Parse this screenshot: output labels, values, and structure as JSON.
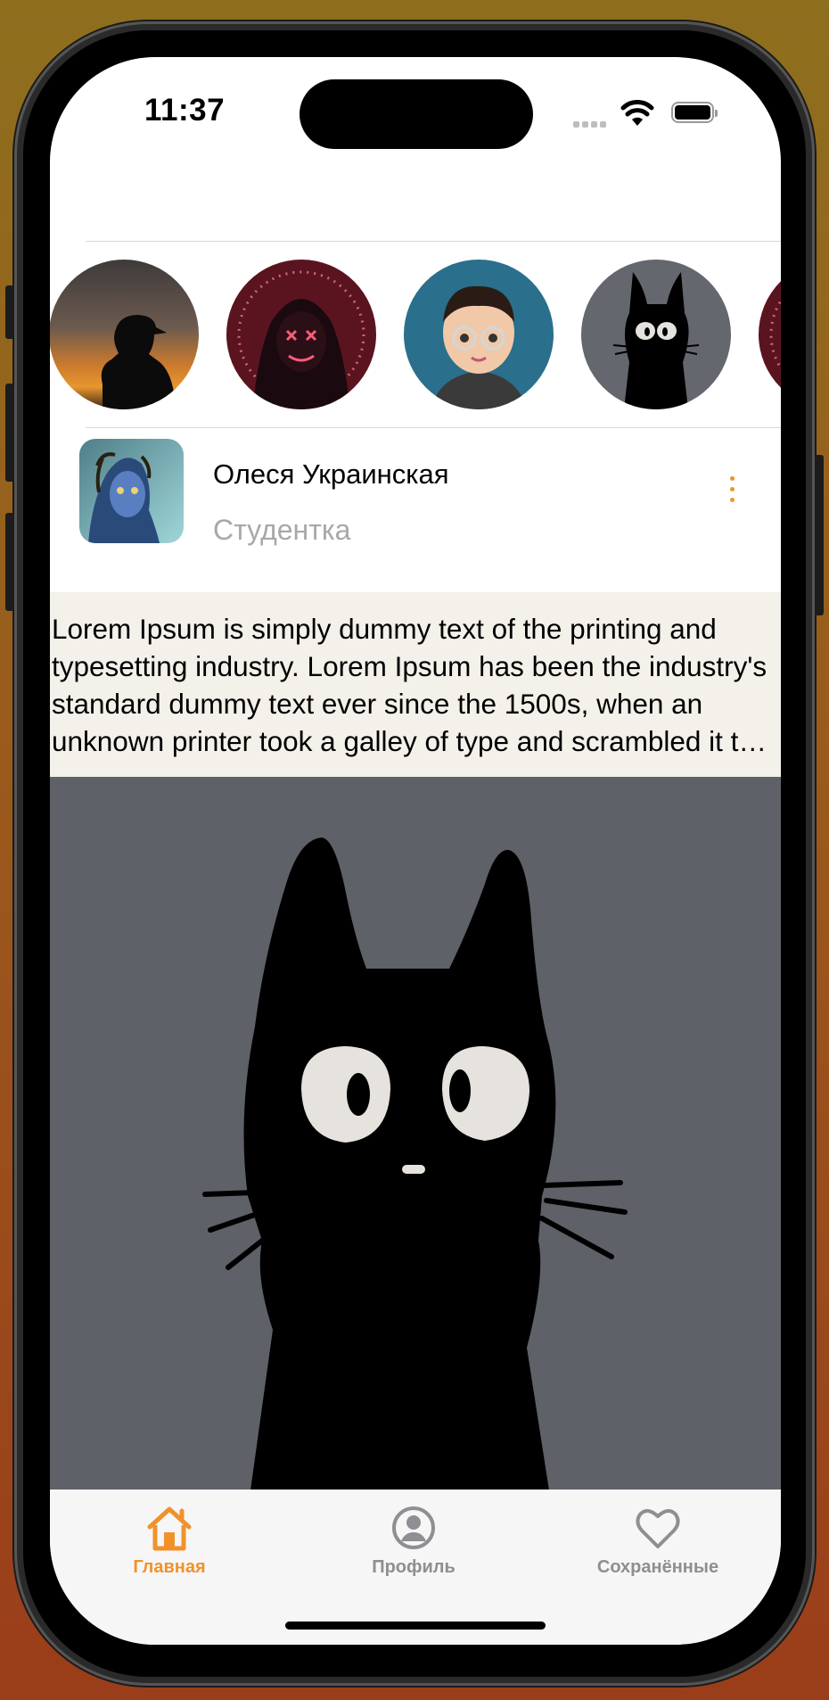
{
  "status_bar": {
    "time": "11:37"
  },
  "stories": [
    {
      "name": "story-silhouette"
    },
    {
      "name": "story-neon-mask"
    },
    {
      "name": "story-cartoon-guy"
    },
    {
      "name": "story-black-cat"
    },
    {
      "name": "story-neon-mask-2"
    }
  ],
  "post": {
    "author_name": "Олеся Украинская",
    "author_role": "Студентка",
    "text": "Lorem Ipsum is simply dummy text of the printing and typesetting industry. Lorem Ipsum has been the industry's standard dummy text ever since the 1500s, when an unknown printer took a galley of type and scrambled it to make a type specimen book."
  },
  "tab_bar": {
    "tabs": [
      {
        "label": "Главная",
        "icon": "home-icon",
        "active": true
      },
      {
        "label": "Профиль",
        "icon": "person-circle-icon",
        "active": false
      },
      {
        "label": "Сохранённые",
        "icon": "heart-icon",
        "active": false
      }
    ]
  },
  "colors": {
    "accent": "#f0922b",
    "inactive": "#8e8e93",
    "post_text_bg": "#f4f0ea",
    "image_bg": "#5f6168"
  }
}
